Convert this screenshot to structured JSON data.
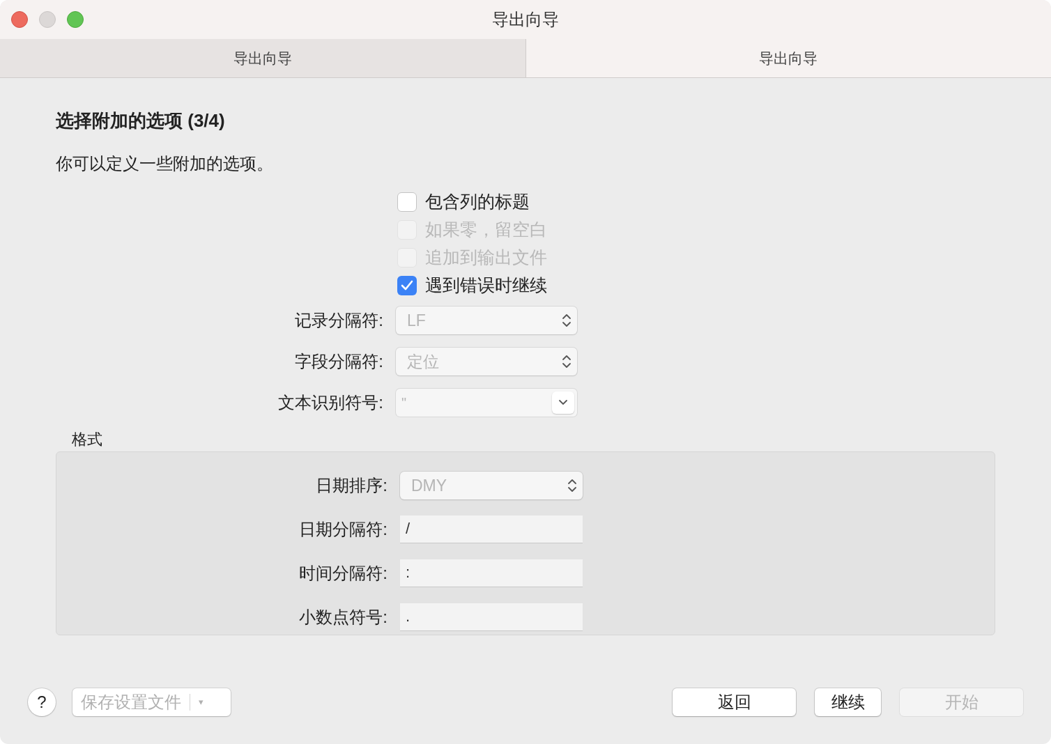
{
  "window": {
    "title": "导出向导"
  },
  "tabs": [
    {
      "label": "导出向导",
      "selected": false
    },
    {
      "label": "导出向导",
      "selected": true
    }
  ],
  "heading": "选择附加的选项 (3/4)",
  "description": "你可以定义一些附加的选项。",
  "options": [
    {
      "label": "包含列的标题",
      "checked": false,
      "disabled": false
    },
    {
      "label": "如果零，留空白",
      "checked": false,
      "disabled": true
    },
    {
      "label": "追加到输出文件",
      "checked": false,
      "disabled": true
    },
    {
      "label": "遇到错误时继续",
      "checked": true,
      "disabled": false
    }
  ],
  "fields": [
    {
      "kind": "select",
      "label": "记录分隔符:",
      "value": "LF",
      "disabled": true
    },
    {
      "kind": "select",
      "label": "字段分隔符:",
      "value": "定位",
      "disabled": true
    },
    {
      "kind": "combo",
      "label": "文本识别符号:",
      "value": "\"",
      "disabled": true
    }
  ],
  "format": {
    "title": "格式",
    "fields": [
      {
        "kind": "select",
        "label": "日期排序:",
        "value": "DMY",
        "disabled": true
      },
      {
        "kind": "text",
        "label": "日期分隔符:",
        "value": "/",
        "disabled": false
      },
      {
        "kind": "text",
        "label": "时间分隔符:",
        "value": ":",
        "disabled": false
      },
      {
        "kind": "text",
        "label": "小数点符号:",
        "value": ".",
        "disabled": false
      }
    ]
  },
  "footer": {
    "help": "?",
    "save": {
      "label": "保存设置文件",
      "caret": "▾",
      "disabled": true
    },
    "buttons": [
      {
        "label": "返回",
        "disabled": false
      },
      {
        "label": "继续",
        "disabled": false
      },
      {
        "label": "开始",
        "disabled": true
      }
    ]
  }
}
